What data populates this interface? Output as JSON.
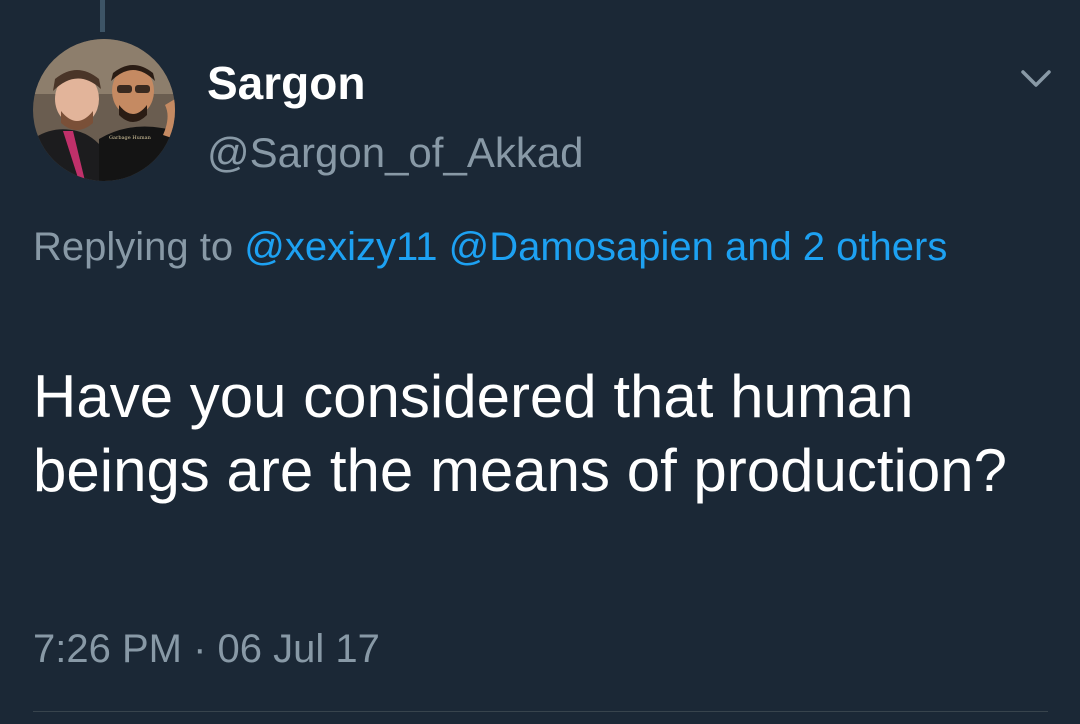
{
  "tweet": {
    "display_name": "Sargon",
    "handle": "@Sargon_of_Akkad",
    "avatar_shirt_text": "Garbage Human",
    "reply": {
      "prefix": "Replying to",
      "mention_1": "@xexizy11",
      "mention_2": "@Damosapien",
      "others": "and 2 others"
    },
    "text": "Have you considered that human beings are the means of production?",
    "time": "7:26 PM",
    "separator": "·",
    "date": "06 Jul 17",
    "menu_icon": "chevron-down-icon"
  },
  "colors": {
    "background": "#1b2836",
    "primary_text": "#ffffff",
    "secondary_text": "#8899a6",
    "link": "#1da1f2",
    "divider": "#38444d"
  }
}
